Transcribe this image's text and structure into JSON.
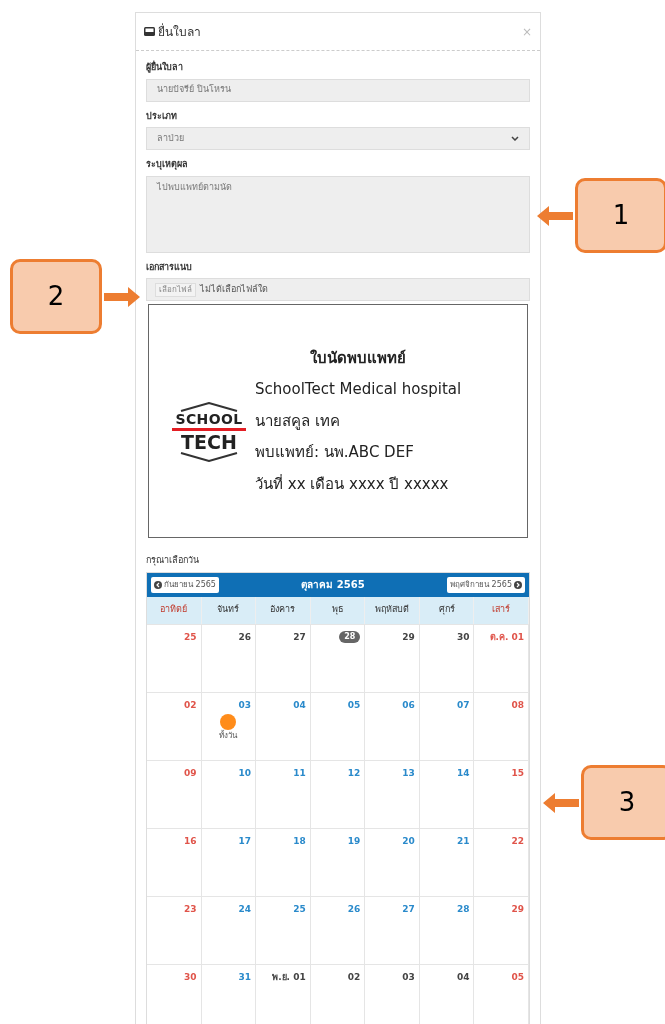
{
  "modal": {
    "title": "ยื่นใบลา",
    "close": "×"
  },
  "form": {
    "applicant": {
      "label": "ผู้ยื่นใบลา",
      "value": "นายปัจรีย์ ปินโหรน"
    },
    "type": {
      "label": "ประเภท",
      "value": "ลาป่วย"
    },
    "reason": {
      "label": "ระบุเหตุผล",
      "value": "ไปพบแพทย์ตามนัด"
    },
    "attachment": {
      "label": "เอกสารแนบ",
      "button": "เลือกไฟล์",
      "status": "ไม่ได้เลือกไฟล์ใด"
    }
  },
  "document": {
    "logo_top": "SCHOOL",
    "logo_bottom": "TECH",
    "lines": [
      "ใบนัดพบแพทย์",
      "SchoolTect Medical hospital",
      "นายสคูล เทค",
      "พบแพทย์: นพ.ABC DEF",
      "วันที่ xx เดือน xxxx ปี xxxxx"
    ]
  },
  "calendar": {
    "label": "กรุณาเลือกวัน",
    "prev": "กันยายน 2565",
    "title": "ตุลาคม 2565",
    "next": "พฤศจิกายน 2565",
    "weekdays": [
      {
        "label": "อาทิตย์",
        "weekend": true
      },
      {
        "label": "จันทร์",
        "weekend": false
      },
      {
        "label": "อังคาร",
        "weekend": false
      },
      {
        "label": "พุธ",
        "weekend": false
      },
      {
        "label": "พฤหัสบดี",
        "weekend": false
      },
      {
        "label": "ศุกร์",
        "weekend": false
      },
      {
        "label": "เสาร์",
        "weekend": true
      }
    ],
    "weeks": [
      [
        {
          "day": "25",
          "kind": "weekend"
        },
        {
          "day": "26",
          "kind": "muted"
        },
        {
          "day": "27",
          "kind": "muted"
        },
        {
          "day": "28",
          "kind": "today"
        },
        {
          "day": "29",
          "kind": "muted"
        },
        {
          "day": "30",
          "kind": "muted"
        },
        {
          "day": "ต.ค. 01",
          "kind": "weekend"
        }
      ],
      [
        {
          "day": "02",
          "kind": "weekend"
        },
        {
          "day": "03",
          "kind": "current",
          "event": {
            "label": "ทั้งวัน",
            "color": "#ff8c1a"
          }
        },
        {
          "day": "04",
          "kind": "current"
        },
        {
          "day": "05",
          "kind": "current"
        },
        {
          "day": "06",
          "kind": "current"
        },
        {
          "day": "07",
          "kind": "current"
        },
        {
          "day": "08",
          "kind": "weekend"
        }
      ],
      [
        {
          "day": "09",
          "kind": "weekend"
        },
        {
          "day": "10",
          "kind": "current"
        },
        {
          "day": "11",
          "kind": "current"
        },
        {
          "day": "12",
          "kind": "current"
        },
        {
          "day": "13",
          "kind": "current"
        },
        {
          "day": "14",
          "kind": "current"
        },
        {
          "day": "15",
          "kind": "weekend"
        }
      ],
      [
        {
          "day": "16",
          "kind": "weekend"
        },
        {
          "day": "17",
          "kind": "current"
        },
        {
          "day": "18",
          "kind": "current"
        },
        {
          "day": "19",
          "kind": "current"
        },
        {
          "day": "20",
          "kind": "current"
        },
        {
          "day": "21",
          "kind": "current"
        },
        {
          "day": "22",
          "kind": "weekend"
        }
      ],
      [
        {
          "day": "23",
          "kind": "weekend"
        },
        {
          "day": "24",
          "kind": "current"
        },
        {
          "day": "25",
          "kind": "current"
        },
        {
          "day": "26",
          "kind": "current"
        },
        {
          "day": "27",
          "kind": "current"
        },
        {
          "day": "28",
          "kind": "current"
        },
        {
          "day": "29",
          "kind": "weekend"
        }
      ],
      [
        {
          "day": "30",
          "kind": "weekend"
        },
        {
          "day": "31",
          "kind": "current"
        },
        {
          "day": "พ.ย. 01",
          "kind": "muted"
        },
        {
          "day": "02",
          "kind": "muted"
        },
        {
          "day": "03",
          "kind": "muted"
        },
        {
          "day": "04",
          "kind": "muted"
        },
        {
          "day": "05",
          "kind": "weekend"
        }
      ]
    ]
  },
  "callouts": [
    {
      "label": "1",
      "kind": "left"
    },
    {
      "label": "2",
      "kind": "right"
    },
    {
      "label": "3",
      "kind": "left"
    }
  ]
}
